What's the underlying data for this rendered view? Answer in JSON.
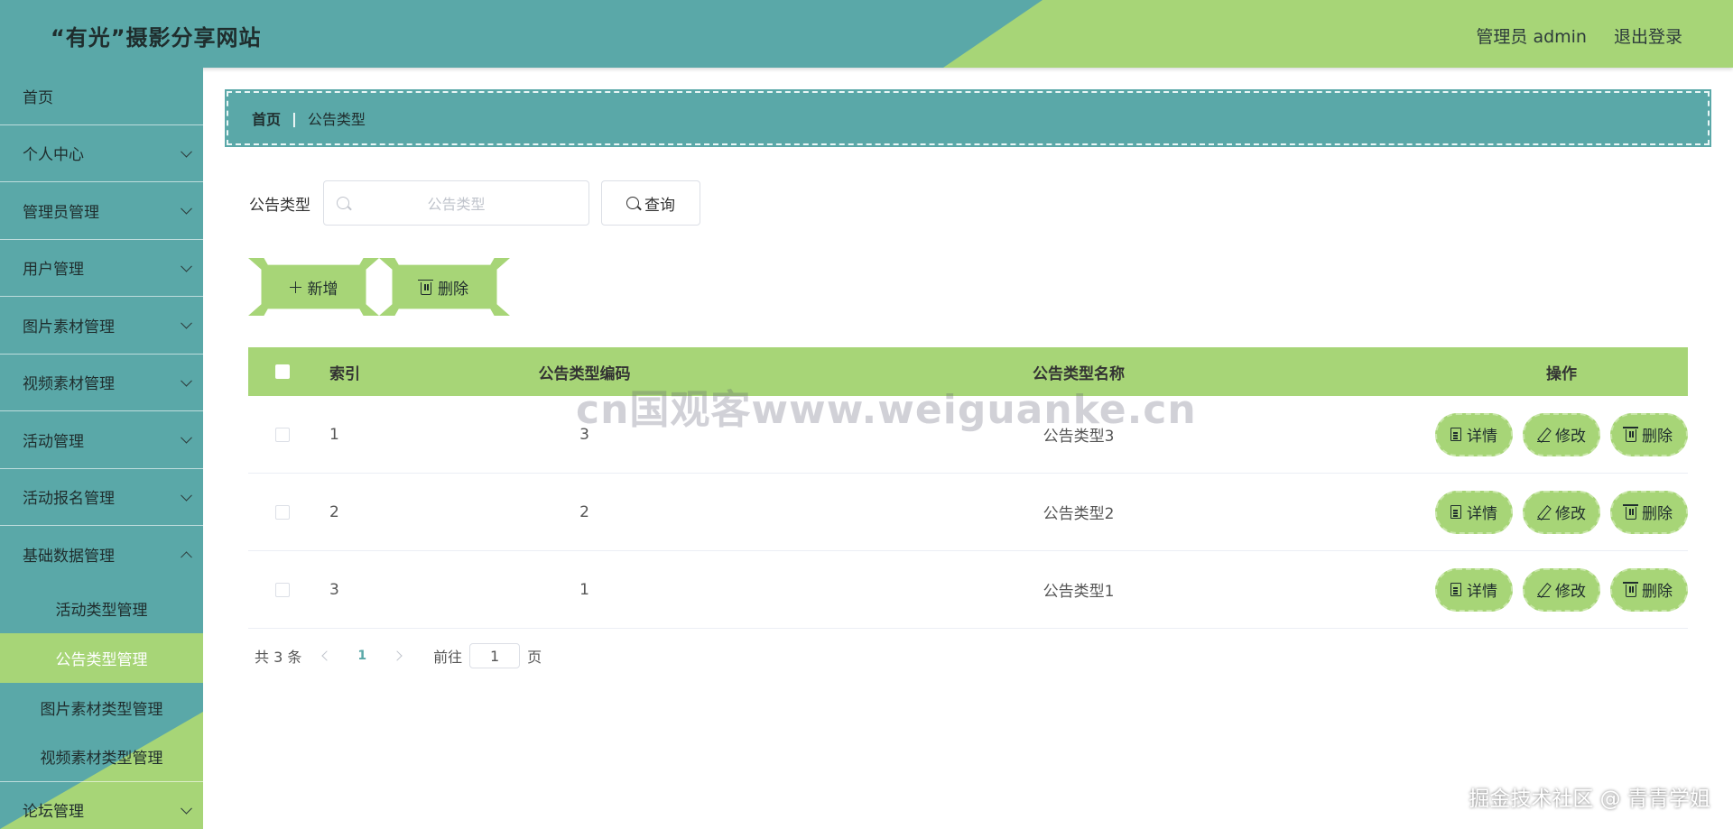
{
  "header": {
    "title": "“有光”摄影分享网站",
    "user_label": "管理员 admin",
    "logout_label": "退出登录",
    "colors": {
      "teal": "#5aa8a8",
      "green": "#a7d577"
    }
  },
  "sidebar": {
    "items": [
      {
        "label": "首页",
        "expandable": false
      },
      {
        "label": "个人中心",
        "expandable": true
      },
      {
        "label": "管理员管理",
        "expandable": true
      },
      {
        "label": "用户管理",
        "expandable": true
      },
      {
        "label": "图片素材管理",
        "expandable": true
      },
      {
        "label": "视频素材管理",
        "expandable": true
      },
      {
        "label": "活动管理",
        "expandable": true
      },
      {
        "label": "活动报名管理",
        "expandable": true
      },
      {
        "label": "基础数据管理",
        "expandable": true,
        "expanded": true
      }
    ],
    "sub_items": [
      {
        "label": "活动类型管理",
        "active": false
      },
      {
        "label": "公告类型管理",
        "active": true
      },
      {
        "label": "图片素材类型管理",
        "active": false
      },
      {
        "label": "视频素材类型管理",
        "active": false
      }
    ],
    "trailing_item": {
      "label": "论坛管理",
      "expandable": true
    }
  },
  "breadcrumb": {
    "home": "首页",
    "separator": "|",
    "current": "公告类型"
  },
  "search": {
    "label": "公告类型",
    "placeholder": "公告类型",
    "query_label": "查询"
  },
  "actions": {
    "add_label": "新增",
    "delete_label": "删除"
  },
  "table": {
    "headers": {
      "index": "索引",
      "code": "公告类型编码",
      "name": "公告类型名称",
      "ops": "操作"
    },
    "rows": [
      {
        "index": "1",
        "code": "3",
        "name": "公告类型3"
      },
      {
        "index": "2",
        "code": "2",
        "name": "公告类型2"
      },
      {
        "index": "3",
        "code": "1",
        "name": "公告类型1"
      }
    ],
    "row_actions": {
      "detail": "详情",
      "edit": "修改",
      "delete": "删除"
    }
  },
  "pagination": {
    "total_text": "共 3 条",
    "current_page": "1",
    "goto_label": "前往",
    "goto_value": "1",
    "page_suffix": "页"
  },
  "watermarks": {
    "center": "cn国观客www.weiguanke.cn",
    "corner": "掘金技术社区 @ 青青学姐"
  }
}
